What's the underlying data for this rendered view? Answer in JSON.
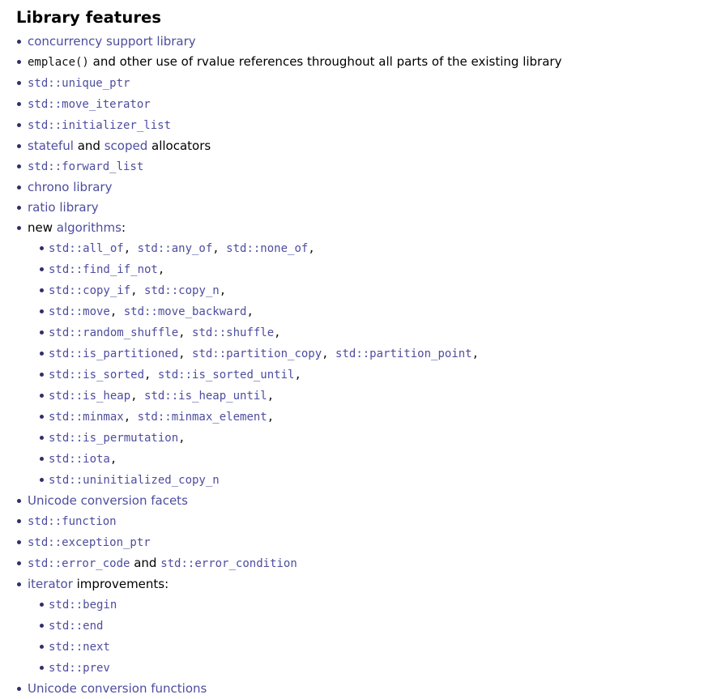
{
  "page": {
    "title": "Library features",
    "link_color": "#4d4da0",
    "code_color": "#111111",
    "bullet_color": "#2f2f6b",
    "background": "#ffffff"
  },
  "items": [
    {
      "id": "concurrency-support-library",
      "parts": [
        {
          "kind": "link",
          "text": "concurrency support library"
        }
      ]
    },
    {
      "id": "emplace-rvalue-references",
      "parts": [
        {
          "kind": "code",
          "text": "emplace()"
        },
        {
          "kind": "text",
          "text": " and other use of rvalue references throughout all parts of the existing library"
        }
      ]
    },
    {
      "id": "std-unique-ptr",
      "parts": [
        {
          "kind": "codelink",
          "text": "std::unique_ptr"
        }
      ]
    },
    {
      "id": "std-move-iterator",
      "parts": [
        {
          "kind": "codelink",
          "text": "std::move_iterator"
        }
      ]
    },
    {
      "id": "std-initializer-list",
      "parts": [
        {
          "kind": "codelink",
          "text": "std::initializer_list"
        }
      ]
    },
    {
      "id": "stateful-scoped-allocators",
      "parts": [
        {
          "kind": "link",
          "text": "stateful"
        },
        {
          "kind": "text",
          "text": " and "
        },
        {
          "kind": "link",
          "text": "scoped"
        },
        {
          "kind": "text",
          "text": " allocators"
        }
      ]
    },
    {
      "id": "std-forward-list",
      "parts": [
        {
          "kind": "codelink",
          "text": "std::forward_list"
        }
      ]
    },
    {
      "id": "chrono-library",
      "parts": [
        {
          "kind": "link",
          "text": "chrono library"
        }
      ]
    },
    {
      "id": "ratio-library",
      "parts": [
        {
          "kind": "link",
          "text": "ratio library"
        }
      ]
    },
    {
      "id": "new-algorithms",
      "parts": [
        {
          "kind": "text",
          "text": "new "
        },
        {
          "kind": "link",
          "text": "algorithms"
        },
        {
          "kind": "text",
          "text": ":"
        }
      ],
      "children": [
        {
          "id": "all-of-any-of-none-of",
          "parts": [
            {
              "kind": "codelink",
              "text": "std::all_of"
            },
            {
              "kind": "code",
              "text": ", "
            },
            {
              "kind": "codelink",
              "text": "std::any_of"
            },
            {
              "kind": "code",
              "text": ", "
            },
            {
              "kind": "codelink",
              "text": "std::none_of"
            },
            {
              "kind": "code",
              "text": ","
            }
          ]
        },
        {
          "id": "find-if-not",
          "parts": [
            {
              "kind": "codelink",
              "text": "std::find_if_not"
            },
            {
              "kind": "code",
              "text": ","
            }
          ]
        },
        {
          "id": "copy-if-copy-n",
          "parts": [
            {
              "kind": "codelink",
              "text": "std::copy_if"
            },
            {
              "kind": "code",
              "text": ", "
            },
            {
              "kind": "codelink",
              "text": "std::copy_n"
            },
            {
              "kind": "code",
              "text": ","
            }
          ]
        },
        {
          "id": "move-move-backward",
          "parts": [
            {
              "kind": "codelink",
              "text": "std::move"
            },
            {
              "kind": "code",
              "text": ", "
            },
            {
              "kind": "codelink",
              "text": "std::move_backward"
            },
            {
              "kind": "code",
              "text": ","
            }
          ]
        },
        {
          "id": "random-shuffle-shuffle",
          "parts": [
            {
              "kind": "codelink",
              "text": "std::random_shuffle"
            },
            {
              "kind": "code",
              "text": ", "
            },
            {
              "kind": "codelink",
              "text": "std::shuffle"
            },
            {
              "kind": "code",
              "text": ","
            }
          ]
        },
        {
          "id": "is-partitioned-partition-copy-partition-point",
          "parts": [
            {
              "kind": "codelink",
              "text": "std::is_partitioned"
            },
            {
              "kind": "code",
              "text": ", "
            },
            {
              "kind": "codelink",
              "text": "std::partition_copy"
            },
            {
              "kind": "code",
              "text": ", "
            },
            {
              "kind": "codelink",
              "text": "std::partition_point"
            },
            {
              "kind": "code",
              "text": ","
            }
          ]
        },
        {
          "id": "is-sorted-is-sorted-until",
          "parts": [
            {
              "kind": "codelink",
              "text": "std::is_sorted"
            },
            {
              "kind": "code",
              "text": ", "
            },
            {
              "kind": "codelink",
              "text": "std::is_sorted_until"
            },
            {
              "kind": "code",
              "text": ","
            }
          ]
        },
        {
          "id": "is-heap-is-heap-until",
          "parts": [
            {
              "kind": "codelink",
              "text": "std::is_heap"
            },
            {
              "kind": "code",
              "text": ", "
            },
            {
              "kind": "codelink",
              "text": "std::is_heap_until"
            },
            {
              "kind": "code",
              "text": ","
            }
          ]
        },
        {
          "id": "minmax-minmax-element",
          "parts": [
            {
              "kind": "codelink",
              "text": "std::minmax"
            },
            {
              "kind": "code",
              "text": ", "
            },
            {
              "kind": "codelink",
              "text": "std::minmax_element"
            },
            {
              "kind": "code",
              "text": ","
            }
          ]
        },
        {
          "id": "is-permutation",
          "parts": [
            {
              "kind": "codelink",
              "text": "std::is_permutation"
            },
            {
              "kind": "code",
              "text": ","
            }
          ]
        },
        {
          "id": "iota",
          "parts": [
            {
              "kind": "codelink",
              "text": "std::iota"
            },
            {
              "kind": "code",
              "text": ","
            }
          ]
        },
        {
          "id": "uninitialized-copy-n",
          "parts": [
            {
              "kind": "codelink",
              "text": "std::uninitialized_copy_n"
            }
          ]
        }
      ]
    },
    {
      "id": "unicode-conversion-facets",
      "parts": [
        {
          "kind": "link",
          "text": "Unicode conversion facets"
        }
      ]
    },
    {
      "id": "std-function",
      "parts": [
        {
          "kind": "codelink",
          "text": "std::function"
        }
      ]
    },
    {
      "id": "std-exception-ptr",
      "parts": [
        {
          "kind": "codelink",
          "text": "std::exception_ptr"
        }
      ]
    },
    {
      "id": "std-error-code-error-condition",
      "parts": [
        {
          "kind": "codelink",
          "text": "std::error_code"
        },
        {
          "kind": "text",
          "text": " and "
        },
        {
          "kind": "codelink",
          "text": "std::error_condition"
        }
      ]
    },
    {
      "id": "iterator-improvements",
      "parts": [
        {
          "kind": "link",
          "text": "iterator"
        },
        {
          "kind": "text",
          "text": " improvements:"
        }
      ],
      "children": [
        {
          "id": "std-begin",
          "parts": [
            {
              "kind": "codelink",
              "text": "std::begin"
            }
          ]
        },
        {
          "id": "std-end",
          "parts": [
            {
              "kind": "codelink",
              "text": "std::end"
            }
          ]
        },
        {
          "id": "std-next",
          "parts": [
            {
              "kind": "codelink",
              "text": "std::next"
            }
          ]
        },
        {
          "id": "std-prev",
          "parts": [
            {
              "kind": "codelink",
              "text": "std::prev"
            }
          ]
        }
      ]
    },
    {
      "id": "unicode-conversion-functions",
      "parts": [
        {
          "kind": "link",
          "text": "Unicode conversion functions"
        }
      ]
    }
  ]
}
